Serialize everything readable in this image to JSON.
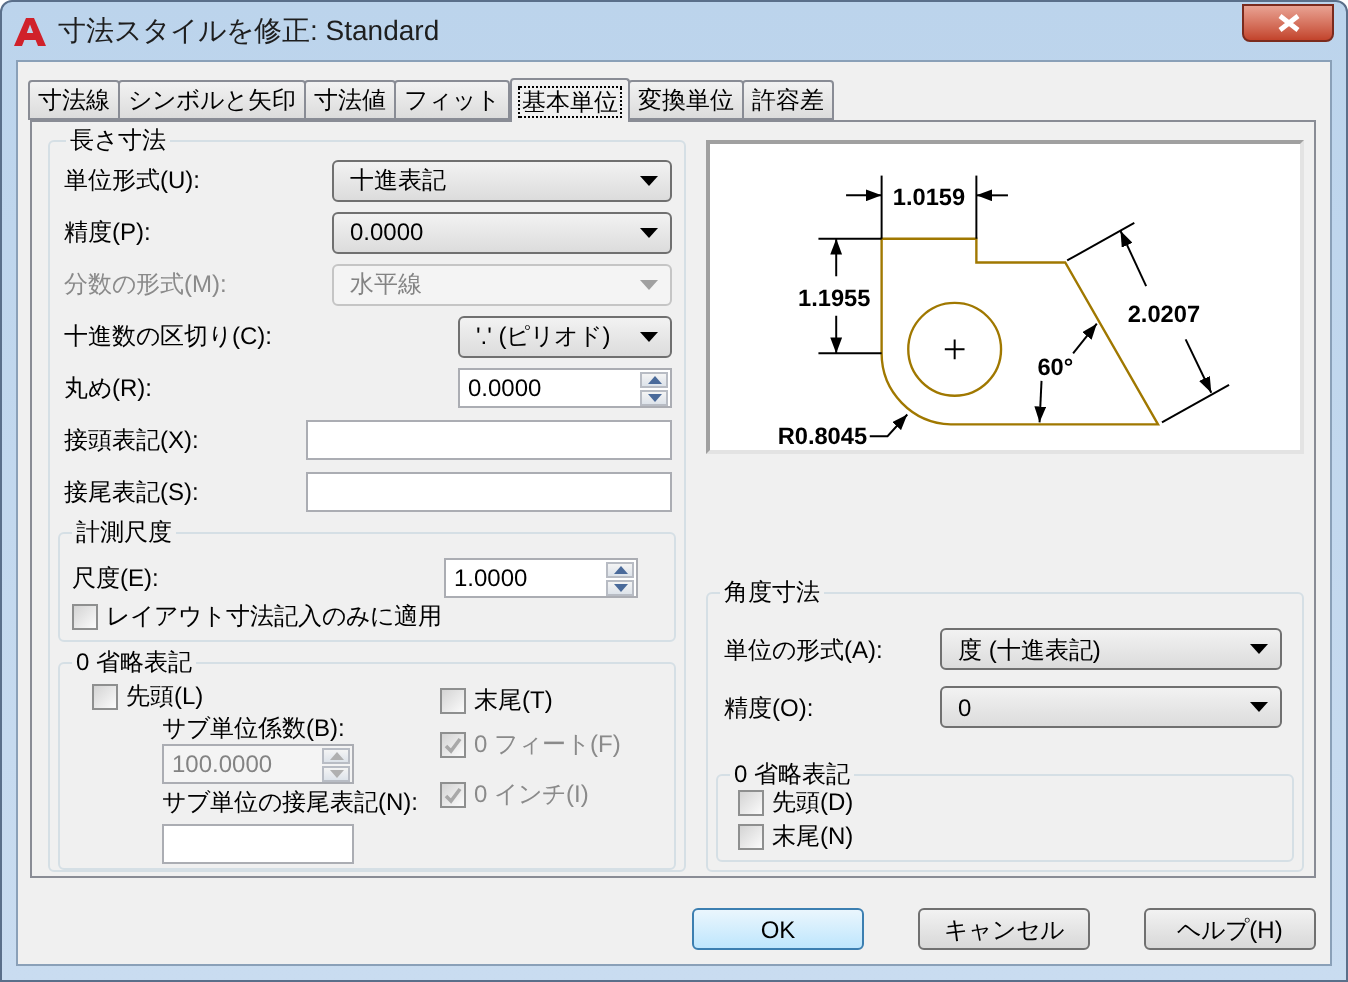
{
  "window": {
    "title": "寸法スタイルを修正: Standard"
  },
  "tabs": [
    {
      "label": "寸法線",
      "selected": false
    },
    {
      "label": "シンボルと矢印",
      "selected": false
    },
    {
      "label": "寸法値",
      "selected": false
    },
    {
      "label": "フィット",
      "selected": false
    },
    {
      "label": "基本単位",
      "selected": true
    },
    {
      "label": "変換単位",
      "selected": false
    },
    {
      "label": "許容差",
      "selected": false
    }
  ],
  "linear": {
    "title": "長さ寸法",
    "rows": [
      {
        "kind": "dropdown",
        "label": "単位形式(U):",
        "value": "十進表記",
        "disabled": false
      },
      {
        "kind": "dropdown",
        "label": "精度(P):",
        "value": "0.0000",
        "disabled": false
      },
      {
        "kind": "dropdown",
        "label": "分数の形式(M):",
        "value": "水平線",
        "disabled": true
      },
      {
        "kind": "dropdown",
        "label": "十進数の区切り(C):",
        "value": "'.' (ピリオド)",
        "disabled": false
      },
      {
        "kind": "spinner",
        "label": "丸め(R):",
        "value": "0.0000"
      },
      {
        "kind": "text",
        "label": "接頭表記(X):"
      },
      {
        "kind": "text",
        "label": "接尾表記(S):"
      }
    ]
  },
  "scale": {
    "title": "計測尺度",
    "label": "尺度(E):",
    "value": "1.0000",
    "layout_only": {
      "label": "レイアウト寸法記入のみに適用",
      "checked": false
    }
  },
  "zero_suppression": {
    "title": "0 省略表記",
    "leading": {
      "label": "先頭(L)",
      "checked": false
    },
    "sub_unit_factor": {
      "label": "サブ単位係数(B):",
      "value": "100.0000",
      "disabled": true
    },
    "sub_unit_suffix": {
      "label": "サブ単位の接尾表記(N):"
    },
    "trailing": {
      "label": "末尾(T)",
      "checked": false
    },
    "feet": {
      "label": "0 フィート(F)",
      "checked": true,
      "disabled": true
    },
    "inches": {
      "label": "0 インチ(I)",
      "checked": true,
      "disabled": true
    }
  },
  "preview": {
    "labels": [
      "1.0159",
      "1.1955",
      "2.0207",
      "60°",
      "R0.8045"
    ]
  },
  "angular": {
    "title": "角度寸法",
    "rows": [
      {
        "kind": "dropdown",
        "label": "単位の形式(A):",
        "value": "度 (十進表記)",
        "disabled": false
      },
      {
        "kind": "dropdown",
        "label": "精度(O):",
        "value": "0",
        "disabled": false
      }
    ],
    "zero_suppression": {
      "title": "0 省略表記",
      "items": [
        {
          "label": "先頭(D)",
          "checked": false
        },
        {
          "label": "末尾(N)",
          "checked": false
        }
      ]
    }
  },
  "buttons": [
    {
      "label": "OK",
      "default": true
    },
    {
      "label": "キャンセル",
      "default": false
    },
    {
      "label": "ヘルプ(H)",
      "default": false
    }
  ]
}
